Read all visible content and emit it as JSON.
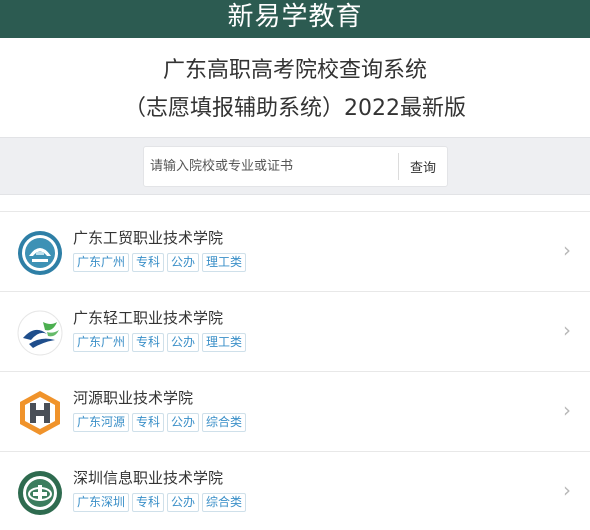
{
  "header": {
    "brand": "新易学教育"
  },
  "page": {
    "title_line1": "广东高职高考院校查询系统",
    "title_line2": "（志愿填报辅助系统）2022最新版"
  },
  "search": {
    "placeholder": "请输入院校或专业或证书",
    "button_label": "查询"
  },
  "colors": {
    "brand_bar": "#2c5b51",
    "tag_text": "#3a8fc8",
    "search_band": "#eeeff2"
  },
  "schools": [
    {
      "name": "广东工贸职业技术学院",
      "tags": [
        "广东广州",
        "专科",
        "公办",
        "理工类"
      ],
      "logo": "gdgm-logo-icon",
      "chevron": "›"
    },
    {
      "name": "广东轻工职业技术学院",
      "tags": [
        "广东广州",
        "专科",
        "公办",
        "理工类"
      ],
      "logo": "gdqg-logo-icon",
      "chevron": "›"
    },
    {
      "name": "河源职业技术学院",
      "tags": [
        "广东河源",
        "专科",
        "公办",
        "综合类"
      ],
      "logo": "hyzy-logo-icon",
      "chevron": "›"
    },
    {
      "name": "深圳信息职业技术学院",
      "tags": [
        "广东深圳",
        "专科",
        "公办",
        "综合类"
      ],
      "logo": "szxx-logo-icon",
      "chevron": "›"
    }
  ]
}
